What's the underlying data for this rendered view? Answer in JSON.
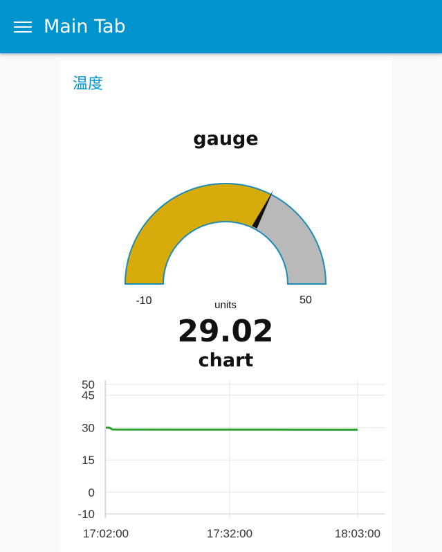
{
  "header": {
    "title": "Main Tab",
    "color": "#0094ce",
    "menu_icon": "hamburger-menu-icon"
  },
  "group": {
    "title": "温度"
  },
  "gauge": {
    "title": "gauge",
    "value": "29.02",
    "min": "-10",
    "max": "50",
    "units": "units",
    "fill_color": "#d7ac0a",
    "track_color": "#b9b9b9",
    "border_color": "#1c8bb5"
  },
  "chart": {
    "title": "chart"
  },
  "chart_data": {
    "type": "line",
    "title": "chart",
    "xlabel": "",
    "ylabel": "",
    "ylim": [
      -10,
      50
    ],
    "y_ticks": [
      "50",
      "45",
      "30",
      "15",
      "0",
      "-10"
    ],
    "x_ticks": [
      "17:02:00",
      "17:32:00",
      "18:03:00"
    ],
    "x_tick_minutes": [
      0,
      30,
      61
    ],
    "line_color": "#2ca02c",
    "grid": true,
    "series": [
      {
        "x_minutes": [
          0,
          0.8,
          1.6,
          61
        ],
        "values": [
          30,
          30,
          29.1,
          29.02
        ]
      }
    ]
  }
}
